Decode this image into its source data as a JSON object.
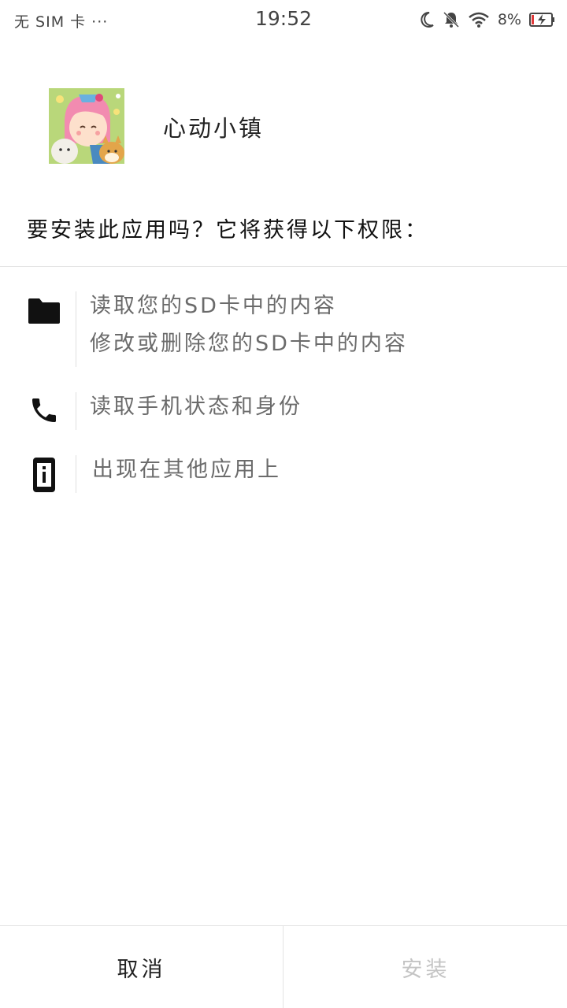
{
  "status_bar": {
    "carrier": "无 SIM 卡 ···",
    "time": "19:52",
    "battery": "8%"
  },
  "app": {
    "name": "心动小镇"
  },
  "prompt": "要安装此应用吗？它将获得以下权限：",
  "permissions": [
    {
      "icon": "folder-icon",
      "lines": [
        "读取您的SD卡中的内容",
        "修改或删除您的SD卡中的内容"
      ]
    },
    {
      "icon": "phone-icon",
      "lines": [
        "读取手机状态和身份"
      ]
    },
    {
      "icon": "overlay-icon",
      "lines": [
        "出现在其他应用上"
      ]
    }
  ],
  "buttons": {
    "cancel": "取消",
    "install": "安装"
  },
  "colors": {
    "text_primary": "#111111",
    "text_secondary": "#6b6b6b",
    "install_disabled": "#c4c4c4",
    "divider": "#e3e3e3"
  }
}
